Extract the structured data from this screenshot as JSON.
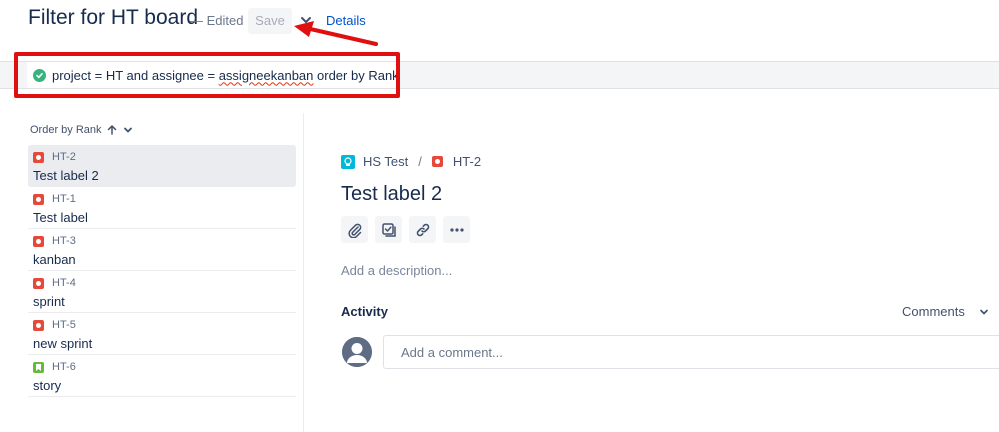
{
  "header": {
    "title": "Filter for HT board",
    "edited": "— Edited",
    "save_label": "Save",
    "details_label": "Details"
  },
  "jql": {
    "status_icon": "check-circle-icon",
    "query_before": "project = HT and assignee = ",
    "query_misspelled": "assigneekanban",
    "query_after": " order by Rank"
  },
  "sort": {
    "label": "Order by Rank"
  },
  "issues": [
    {
      "key": "HT-2",
      "summary": "Test label 2",
      "type": "bug",
      "selected": true
    },
    {
      "key": "HT-1",
      "summary": "Test label",
      "type": "bug",
      "selected": false
    },
    {
      "key": "HT-3",
      "summary": "kanban",
      "type": "bug",
      "selected": false
    },
    {
      "key": "HT-4",
      "summary": "sprint",
      "type": "bug",
      "selected": false
    },
    {
      "key": "HT-5",
      "summary": "new sprint",
      "type": "bug",
      "selected": false
    },
    {
      "key": "HT-6",
      "summary": "story",
      "type": "story",
      "selected": false
    }
  ],
  "detail": {
    "project": "HS Test",
    "separator": "/",
    "issue_key": "HT-2",
    "title": "Test label 2",
    "description_placeholder": "Add a description...",
    "activity_label": "Activity",
    "comments_select": "Comments",
    "comment_placeholder": "Add a comment..."
  },
  "colors": {
    "accent": "#0052cc",
    "bug": "#e5493a",
    "story": "#63ba3c",
    "annotation": "#e01010",
    "valid": "#36b37e"
  }
}
